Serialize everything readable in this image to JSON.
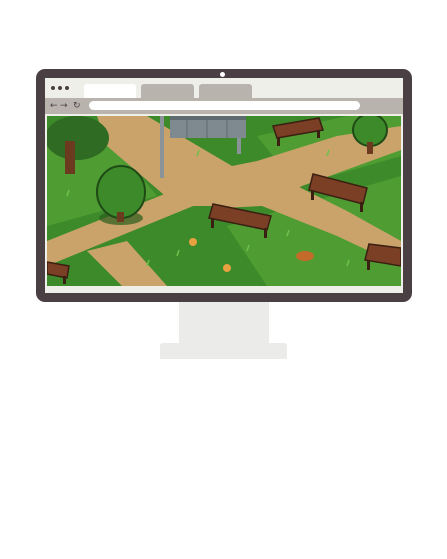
{
  "browser": {
    "window_controls": [
      "menu-dot",
      "menu-dot",
      "menu-dot"
    ],
    "tabs": [
      {
        "label": "",
        "active": true
      },
      {
        "label": "",
        "active": false
      },
      {
        "label": "",
        "active": false
      }
    ],
    "nav": {
      "back_icon": "←",
      "forward_icon": "→",
      "reload_icon": "↻"
    },
    "address_bar": {
      "value": ""
    }
  },
  "scene": {
    "type": "pixel-art park",
    "colors": {
      "grass": "#3c8a2a",
      "grass_light": "#5aa83a",
      "path": "#c9a36a",
      "bench": "#7a3f24",
      "tree_dark": "#2f6b22",
      "trunk": "#6b3a1f",
      "frame": "#4a3f43"
    }
  }
}
